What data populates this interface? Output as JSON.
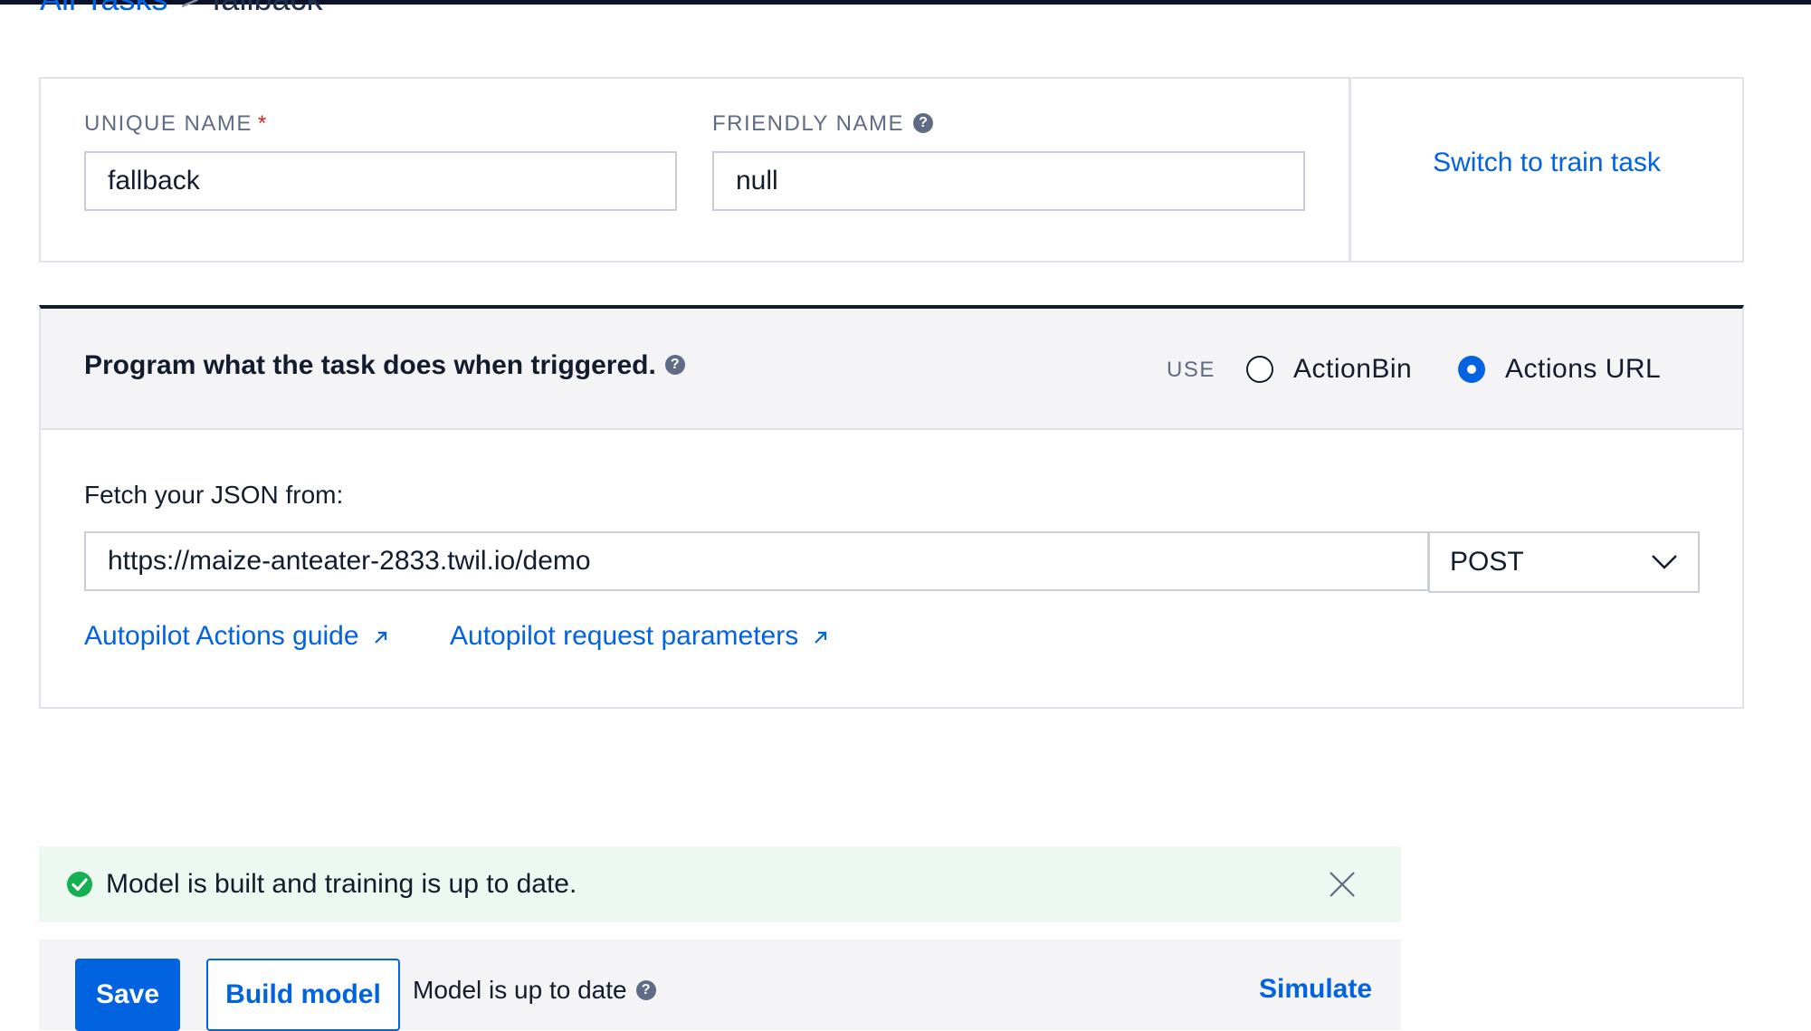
{
  "breadcrumb": {
    "parent": "All Tasks",
    "separator": ">",
    "current": "fallback"
  },
  "unique_name": {
    "label": "UNIQUE NAME",
    "required_mark": "*",
    "value": "fallback"
  },
  "friendly_name": {
    "label": "FRIENDLY NAME",
    "value": "null"
  },
  "switch_link": "Switch to train task",
  "program": {
    "title": "Program what the task does when triggered.",
    "use_label": "USE",
    "options": [
      {
        "label": "ActionBin",
        "selected": false
      },
      {
        "label": "Actions URL",
        "selected": true
      }
    ],
    "fetch_label": "Fetch your JSON from:",
    "url_value": "https://maize-anteater-2833.twil.io/demo",
    "method": "POST",
    "links": [
      {
        "label": "Autopilot Actions guide",
        "icon": "external-link-icon"
      },
      {
        "label": "Autopilot request parameters",
        "icon": "external-link-icon"
      }
    ]
  },
  "status_banner": {
    "message": "Model is built and training is up to date.",
    "icon": "check-circle-icon"
  },
  "footer": {
    "save_label": "Save",
    "build_label": "Build model",
    "model_status": "Model is up to date",
    "simulate_label": "Simulate"
  },
  "colors": {
    "link": "#0263e0",
    "success": "#14b053",
    "success_bg": "#edf8f0",
    "header_bg": "#f4f4f6"
  }
}
